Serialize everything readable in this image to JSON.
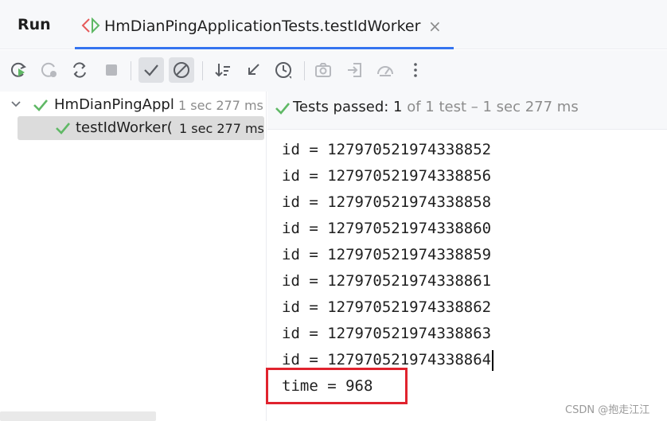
{
  "header": {
    "run_label": "Run",
    "tab_title": "HmDianPingApplicationTests.testIdWorker",
    "tab_close": "×"
  },
  "toolbar": {
    "buttons": [
      {
        "name": "rerun-icon"
      },
      {
        "name": "rerun-failed-icon"
      },
      {
        "name": "toggle-auto-test-icon"
      },
      {
        "name": "stop-icon"
      },
      {
        "name": "show-passed-icon",
        "active": true
      },
      {
        "name": "show-ignored-icon",
        "active": true
      },
      {
        "name": "sort-icon"
      },
      {
        "name": "collapse-icon"
      },
      {
        "name": "history-icon"
      },
      {
        "name": "screenshot-icon"
      },
      {
        "name": "import-icon"
      },
      {
        "name": "dashboard-icon"
      },
      {
        "name": "more-icon"
      }
    ]
  },
  "tree": {
    "items": [
      {
        "name": "HmDianPingAppl",
        "time": "1 sec 277 ms"
      },
      {
        "name": "testIdWorker(",
        "time": "1 sec 277 ms"
      }
    ]
  },
  "status": {
    "prefix": "Tests passed: 1",
    "suffix": " of 1 test – 1 sec 277 ms"
  },
  "console": {
    "lines": [
      "id = 127970521974338852",
      "id = 127970521974338856",
      "id = 127970521974338858",
      "id = 127970521974338860",
      "id = 127970521974338859",
      "id = 127970521974338861",
      "id = 127970521974338862",
      "id = 127970521974338863",
      "id = 127970521974338864",
      "time = 968"
    ]
  },
  "watermark": "CSDN @抱走江江",
  "colors": {
    "accent": "#3574f0",
    "success": "#5fb865",
    "highlight": "#e0232e"
  }
}
